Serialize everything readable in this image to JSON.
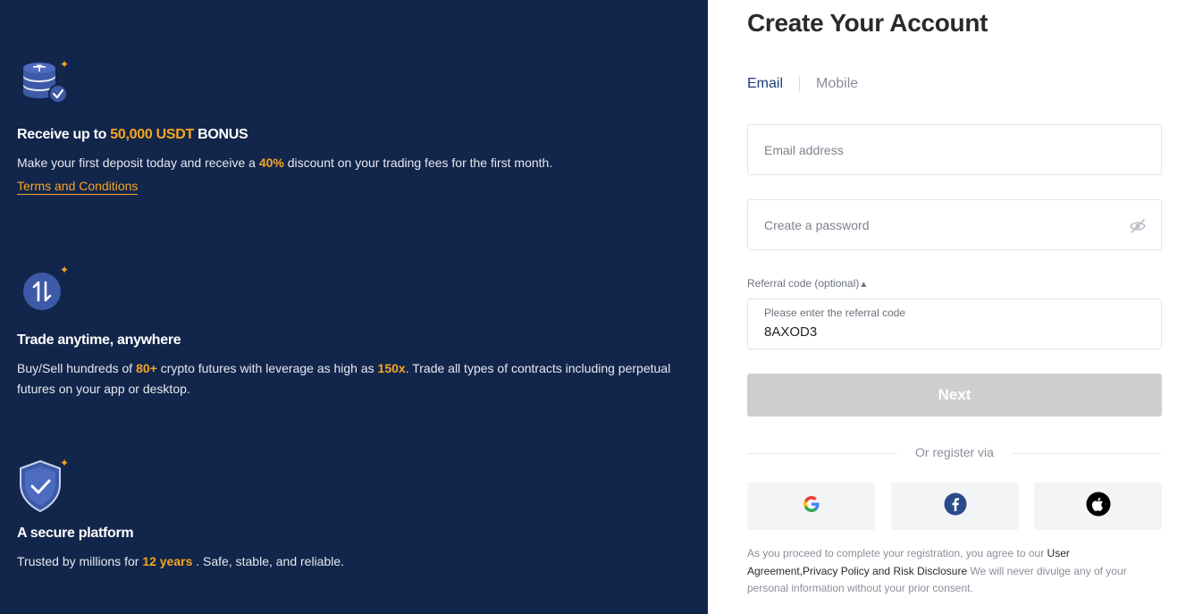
{
  "promo": {
    "bonus": {
      "title_prefix": "Receive up to",
      "title_amount": "50,000 USDT",
      "title_suffix": "BONUS",
      "desc_prefix": "Make your first deposit today and receive a",
      "desc_discount": "40%",
      "desc_suffix": "discount on your trading fees for the first month.",
      "link": "Terms and Conditions",
      "icon": "usdt-coins-check-icon"
    },
    "trade": {
      "title": "Trade anytime, anywhere",
      "desc_1": "Buy/Sell hundreds of",
      "desc_count": "80+",
      "desc_2": "crypto futures with leverage as high as",
      "desc_leverage": "150x",
      "desc_3": ". Trade all types of contracts including perpetual futures on your app or desktop.",
      "icon": "arrows-up-down-icon"
    },
    "secure": {
      "title": "A secure platform",
      "desc_1": "Trusted by millions for",
      "desc_years": "12 years",
      "desc_2": ". Safe, stable, and reliable.",
      "icon": "shield-check-icon"
    }
  },
  "form": {
    "title": "Create Your Account",
    "tabs": [
      {
        "label": "Email",
        "active": true
      },
      {
        "label": "Mobile",
        "active": false
      }
    ],
    "email_placeholder": "Email address",
    "password_placeholder": "Create a password",
    "referral_label": "Referral code (optional)",
    "referral_toggle": "▲",
    "referral_placeholder": "Please enter the referral code",
    "referral_value": "8AXOD3",
    "next_label": "Next",
    "divider_text": "Or register via",
    "social": [
      "google-icon",
      "facebook-icon",
      "apple-icon"
    ],
    "legal_prefix": "As you proceed to complete your registration, you agree to our ",
    "legal_link1": "User Agreement,",
    "legal_link2": "Privacy Policy",
    "legal_and": " and ",
    "legal_link3": "Risk Disclosure",
    "legal_suffix": " We will never divulge any of your personal information without your prior consent."
  },
  "colors": {
    "left_bg": "#12254a",
    "accent": "#f5a623",
    "brand_blue": "#1e3c78",
    "button_disabled": "#cfcfcf"
  }
}
